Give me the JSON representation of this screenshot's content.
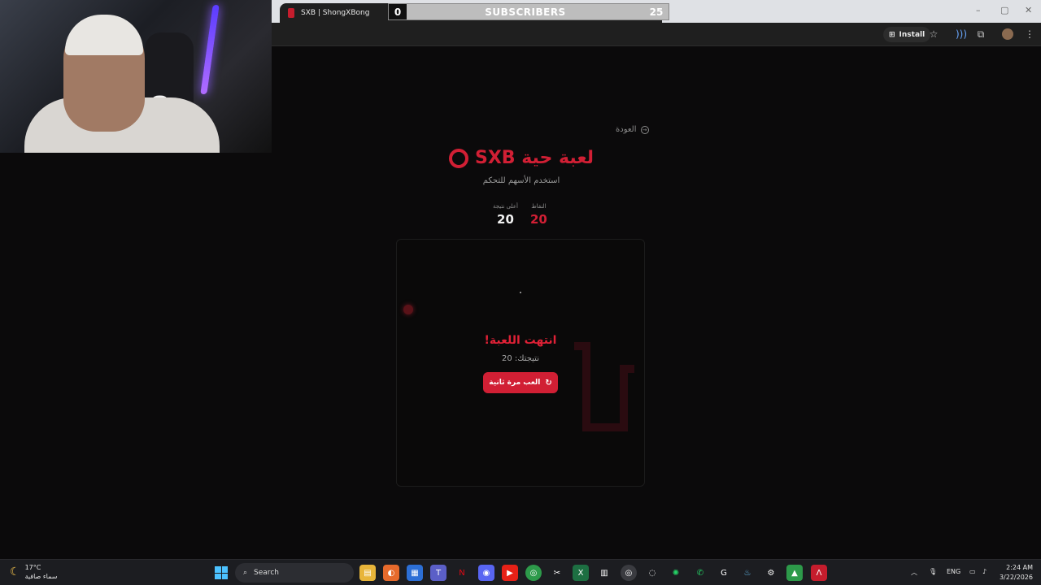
{
  "browser": {
    "tab_title": "SXB | ShongXBong",
    "install_label": "Install"
  },
  "subscriber_overlay": {
    "start_count": "0",
    "label": "SUBSCRIBERS",
    "goal": "25"
  },
  "page": {
    "back_label": "العودة",
    "title": "لعبة حية SXB",
    "subtitle": "استخدم الأسهم للتحكم",
    "stats": {
      "score_label": "النقاط",
      "score_value": "20",
      "best_label": "أعلى نتيجة",
      "best_value": "20"
    },
    "game_over_title": "انتهت اللعبة!",
    "your_score": "نتيجتك: 20",
    "play_again_label": "العب مرة ثانية"
  },
  "taskbar": {
    "weather_temp": "17°C",
    "weather_desc": "سماء صافية",
    "search_label": "Search",
    "language": "ENG",
    "time": "2:24 AM",
    "date": "3/22/2026"
  },
  "colors": {
    "accent": "#d11f34",
    "background": "#0b0a0b"
  }
}
